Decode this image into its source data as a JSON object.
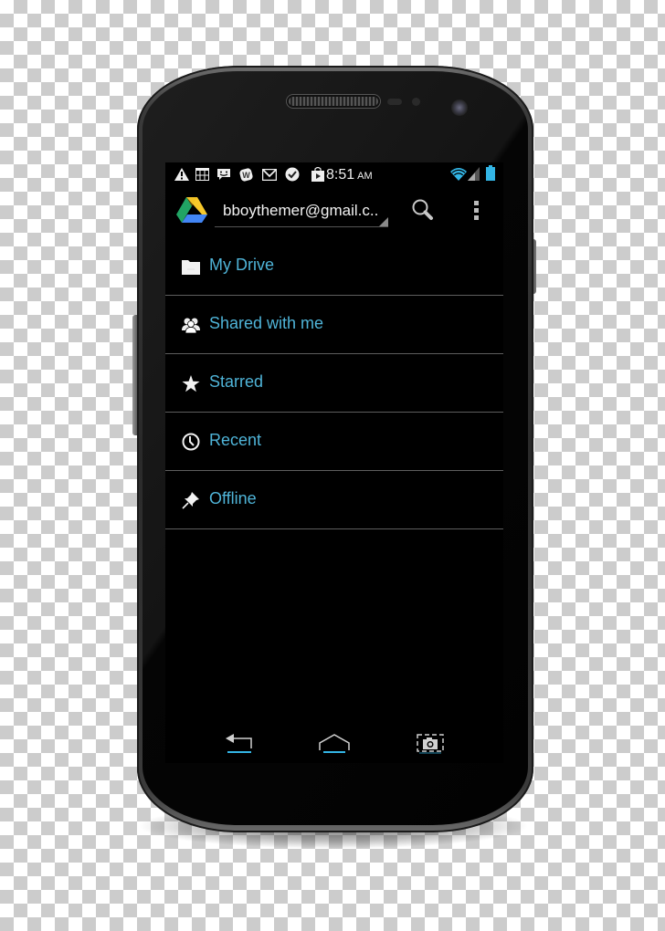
{
  "device": {
    "model": "android-phone"
  },
  "status_bar": {
    "notification_icons": [
      "warning-icon",
      "calendar-icon",
      "sms-icon",
      "wordpress-icon",
      "gmail-icon",
      "check-icon",
      "play-store-icon"
    ],
    "time": "8:51",
    "ampm": "AM",
    "system_icons": [
      "wifi-icon",
      "signal-icon",
      "battery-icon"
    ],
    "accent_color": "#33b5e5"
  },
  "action_bar": {
    "app_icon": "google-drive-icon",
    "account": "bboythemer@gmail.c..",
    "search_icon": "search-icon",
    "overflow_icon": "overflow-menu-icon"
  },
  "nav_items": [
    {
      "label": "My Drive",
      "icon": "folder-icon"
    },
    {
      "label": "Shared with me",
      "icon": "people-icon"
    },
    {
      "label": "Starred",
      "icon": "star-icon"
    },
    {
      "label": "Recent",
      "icon": "clock-icon"
    },
    {
      "label": "Offline",
      "icon": "pin-icon"
    }
  ],
  "colors": {
    "item_text": "#4fb4d8",
    "divider": "#5e5e5e",
    "background": "#000000"
  },
  "system_nav": {
    "buttons": [
      "back-icon",
      "home-icon",
      "screenshot-icon"
    ]
  }
}
